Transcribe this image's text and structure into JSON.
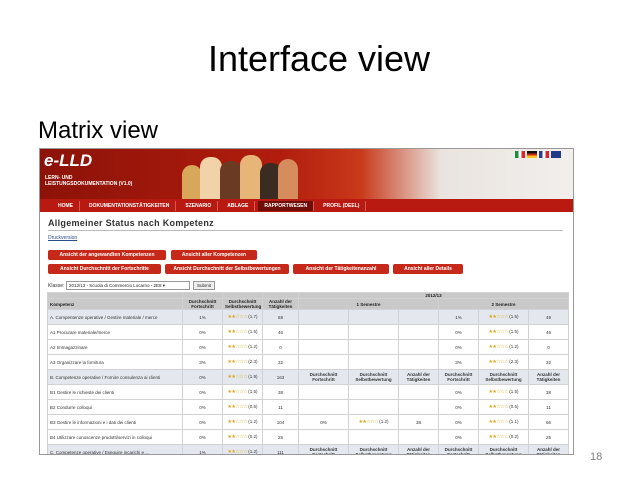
{
  "slide": {
    "title": "Interface view",
    "subtitle": "Matrix view",
    "page_number": "18"
  },
  "app": {
    "logo": "e-LLD",
    "logo_sub_1": "LERN- UND",
    "logo_sub_2": "LEISTUNGSDOKUMENTATION (V1.0)",
    "nav": [
      "HOME",
      "DOKUMENTATIONSTÄTIGKEITEN",
      "SZENARIO",
      "ABLAGE",
      "RAPPORTWESEN",
      "PROFIL (DEEL)"
    ],
    "page_heading": "Allgemeiner Status nach Kompetenz",
    "print_link": "Druckversion",
    "buttons": [
      "Ansicht der angewandten Kompetenzen",
      "Ansicht aller Kompetenzen",
      "Ansicht Durchschnitt der Fortschritte",
      "Ansicht Durchschnitt der Selbstbewertungen",
      "Ansicht der Tätigkeitenanzahl",
      "Ansicht aller Details"
    ],
    "klasse_label": "Klasse:",
    "klasse_value": "2012/13 - Scuola di Commercio Locarno - 2E8 ▾",
    "submit_label": "Submit"
  },
  "table": {
    "year": "2012/13",
    "sem1": "1 Semestre",
    "sem2": "2 Semestre",
    "headers": {
      "kompetenz": "Kompetenz",
      "avg_progress": "Durchschnitt Fortschritt",
      "avg_self": "Durchschnitt Selbstbewertung",
      "count": "Anzahl der Tätigkeiten",
      "s_avg_progress": "Durchschnitt Fortschritt",
      "s_avg_self": "Durchschnitt Selbstbewertung",
      "s_count": "Anzahl der Tätigkeiten"
    },
    "rows": [
      {
        "type": "cat",
        "label": "A. Compentenze operative / Gestire materiale / merce",
        "p": "1%",
        "r": "(1.7)",
        "n": "69",
        "s1p": "",
        "s1r": "",
        "s1n": "",
        "s2p": "1%",
        "s2r": "(1.5)",
        "s2n": "49"
      },
      {
        "type": "item",
        "label": "A1 Procurare materiale/merce",
        "p": "0%",
        "r": "(1.5)",
        "n": "46",
        "s1p": "",
        "s1r": "",
        "s1n": "",
        "s2p": "0%",
        "s2r": "(1.5)",
        "s2n": "46"
      },
      {
        "type": "item",
        "label": "A2 Immagazzinare",
        "p": "0%",
        "r": "(1.2)",
        "n": "0",
        "s1p": "",
        "s1r": "",
        "s1n": "",
        "s2p": "0%",
        "s2r": "(1.2)",
        "s2n": "0"
      },
      {
        "type": "item",
        "label": "A3 Organizzare la fornitura",
        "p": "3%",
        "r": "(2.3)",
        "n": "32",
        "s1p": "",
        "s1r": "",
        "s1n": "",
        "s2p": "3%",
        "s2r": "(2.3)",
        "s2n": "32"
      },
      {
        "type": "cat",
        "label": "B. Competenze operative / Fornire consulenza ai clienti",
        "p": "0%",
        "r": "(1.9)",
        "n": "163",
        "s1p": "Durchschnitt Fortschritt",
        "s1r": "Durchschnitt Selbstbewertung",
        "s1n": "Anzahl der Tätigkeiten",
        "s2p": "Durchschnitt Fortschritt",
        "s2r": "Durchschnitt Selbstbewertung",
        "s2n": "Anzahl der Tätigkeiten"
      },
      {
        "type": "item",
        "label": "B1 Gestire le richieste dei clienti",
        "p": "0%",
        "r": "(1.5)",
        "n": "38",
        "s1p": "",
        "s1r": "",
        "s1n": "",
        "s2p": "0%",
        "s2r": "(1.5)",
        "s2n": "38"
      },
      {
        "type": "item",
        "label": "B2 Condurre colloqui",
        "p": "0%",
        "r": "(0.5)",
        "n": "11",
        "s1p": "",
        "s1r": "",
        "s1n": "",
        "s2p": "0%",
        "s2r": "(0.5)",
        "s2n": "11"
      },
      {
        "type": "item",
        "label": "B3 Gestire le informazioni e i dati dei clienti",
        "p": "0%",
        "r": "(1.2)",
        "n": "104",
        "s1p": "0%",
        "s1r": "(1.2)",
        "s1n": "38",
        "s2p": "0%",
        "s2r": "(1.1)",
        "s2n": "66"
      },
      {
        "type": "item",
        "label": "B4 Utilizzare conoscenze prodotti/servizi in colloqui",
        "p": "0%",
        "r": "(0.2)",
        "n": "25",
        "s1p": "",
        "s1r": "",
        "s1n": "",
        "s2p": "0%",
        "s2r": "(0.2)",
        "s2n": "25"
      },
      {
        "type": "cat",
        "label": "C. Competenze operative / Eseguire incarichi e ...",
        "p": "1%",
        "r": "(1.2)",
        "n": "111",
        "s1p": "Durchschnitt Fortschritt",
        "s1r": "Durchschnitt Selbstbewertung",
        "s1n": "Anzahl der Tätigkeiten",
        "s2p": "Durchschnitt Fortschritt",
        "s2r": "Durchschnitt Selbstbewertung",
        "s2n": "Anzahl der Tätigkeiten"
      }
    ]
  }
}
